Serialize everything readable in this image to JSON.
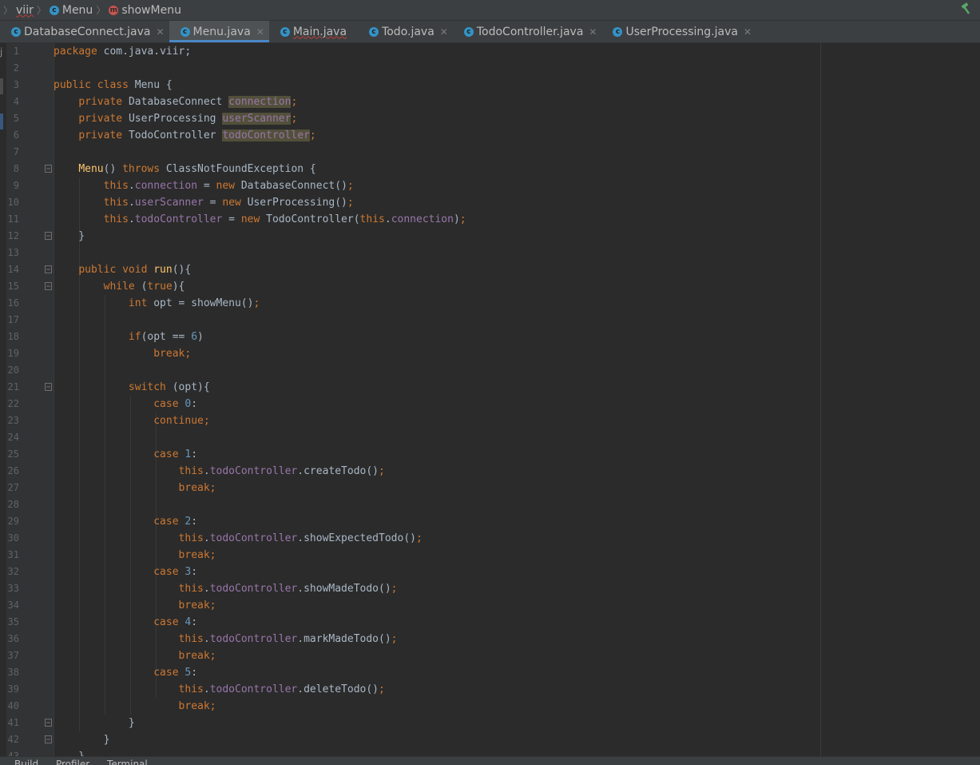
{
  "breadcrumb": {
    "items": [
      {
        "label": "viir",
        "icon": "folder",
        "underline": true
      },
      {
        "label": "Menu",
        "icon": "class-icon"
      },
      {
        "label": "showMenu",
        "icon": "method-icon"
      }
    ]
  },
  "tabs": [
    {
      "label": "DatabaseConnect.java",
      "active": false,
      "error": false
    },
    {
      "label": "Menu.java",
      "active": true,
      "error": false
    },
    {
      "label": "Main.java",
      "active": false,
      "error": true
    },
    {
      "label": "Todo.java",
      "active": false,
      "error": false
    },
    {
      "label": "TodoController.java",
      "active": false,
      "error": false
    },
    {
      "label": "UserProcessing.java",
      "active": false,
      "error": false
    }
  ],
  "code_lines": [
    [
      [
        "kw",
        "package "
      ],
      [
        "t",
        "com.java.viir;"
      ]
    ],
    [],
    [
      [
        "kw",
        "public class "
      ],
      [
        "t",
        "Menu {"
      ]
    ],
    [
      [
        "t",
        "    "
      ],
      [
        "kw",
        "private "
      ],
      [
        "t",
        "DatabaseConnect "
      ],
      [
        "hl",
        "connection"
      ],
      [
        "kw",
        ";"
      ]
    ],
    [
      [
        "t",
        "    "
      ],
      [
        "kw",
        "private "
      ],
      [
        "t",
        "UserProcessing "
      ],
      [
        "hl",
        "userScanner"
      ],
      [
        "kw",
        ";"
      ]
    ],
    [
      [
        "t",
        "    "
      ],
      [
        "kw",
        "private "
      ],
      [
        "t",
        "TodoController "
      ],
      [
        "hl",
        "todoController"
      ],
      [
        "kw",
        ";"
      ]
    ],
    [],
    [
      [
        "t",
        "    "
      ],
      [
        "fn",
        "Menu"
      ],
      [
        "t",
        "() "
      ],
      [
        "kw",
        "throws "
      ],
      [
        "t",
        "ClassNotFoundException {"
      ]
    ],
    [
      [
        "t",
        "        "
      ],
      [
        "kw",
        "this"
      ],
      [
        "t",
        "."
      ],
      [
        "fld",
        "connection"
      ],
      [
        "t",
        " = "
      ],
      [
        "kw",
        "new "
      ],
      [
        "t",
        "DatabaseConnect()"
      ],
      [
        "kw",
        ";"
      ]
    ],
    [
      [
        "t",
        "        "
      ],
      [
        "kw",
        "this"
      ],
      [
        "t",
        "."
      ],
      [
        "fld",
        "userScanner"
      ],
      [
        "t",
        " = "
      ],
      [
        "kw",
        "new "
      ],
      [
        "t",
        "UserProcessing()"
      ],
      [
        "kw",
        ";"
      ]
    ],
    [
      [
        "t",
        "        "
      ],
      [
        "kw",
        "this"
      ],
      [
        "t",
        "."
      ],
      [
        "fld",
        "todoController"
      ],
      [
        "t",
        " = "
      ],
      [
        "kw",
        "new "
      ],
      [
        "t",
        "TodoController("
      ],
      [
        "kw",
        "this"
      ],
      [
        "t",
        "."
      ],
      [
        "fld",
        "connection"
      ],
      [
        "t",
        ")"
      ],
      [
        "kw",
        ";"
      ]
    ],
    [
      [
        "t",
        "    }"
      ]
    ],
    [],
    [
      [
        "t",
        "    "
      ],
      [
        "kw",
        "public void "
      ],
      [
        "fn",
        "run"
      ],
      [
        "t",
        "(){"
      ]
    ],
    [
      [
        "t",
        "        "
      ],
      [
        "kw",
        "while "
      ],
      [
        "t",
        "("
      ],
      [
        "kw",
        "true"
      ],
      [
        "t",
        "){"
      ]
    ],
    [
      [
        "t",
        "            "
      ],
      [
        "kw",
        "int "
      ],
      [
        "t",
        "opt = showMenu()"
      ],
      [
        "kw",
        ";"
      ]
    ],
    [],
    [
      [
        "t",
        "            "
      ],
      [
        "kw",
        "if"
      ],
      [
        "t",
        "(opt == "
      ],
      [
        "num",
        "6"
      ],
      [
        "t",
        ")"
      ]
    ],
    [
      [
        "t",
        "                "
      ],
      [
        "kw",
        "break;"
      ]
    ],
    [],
    [
      [
        "t",
        "            "
      ],
      [
        "kw",
        "switch "
      ],
      [
        "t",
        "(opt){"
      ]
    ],
    [
      [
        "t",
        "                "
      ],
      [
        "kw",
        "case "
      ],
      [
        "num",
        "0"
      ],
      [
        "t",
        ":"
      ]
    ],
    [
      [
        "t",
        "                "
      ],
      [
        "kw",
        "continue;"
      ]
    ],
    [],
    [
      [
        "t",
        "                "
      ],
      [
        "kw",
        "case "
      ],
      [
        "num",
        "1"
      ],
      [
        "t",
        ":"
      ]
    ],
    [
      [
        "t",
        "                    "
      ],
      [
        "kw",
        "this"
      ],
      [
        "t",
        "."
      ],
      [
        "fld",
        "todoController"
      ],
      [
        "t",
        ".createTodo()"
      ],
      [
        "kw",
        ";"
      ]
    ],
    [
      [
        "t",
        "                    "
      ],
      [
        "kw",
        "break;"
      ]
    ],
    [],
    [
      [
        "t",
        "                "
      ],
      [
        "kw",
        "case "
      ],
      [
        "num",
        "2"
      ],
      [
        "t",
        ":"
      ]
    ],
    [
      [
        "t",
        "                    "
      ],
      [
        "kw",
        "this"
      ],
      [
        "t",
        "."
      ],
      [
        "fld",
        "todoController"
      ],
      [
        "t",
        ".showExpectedTodo()"
      ],
      [
        "kw",
        ";"
      ]
    ],
    [
      [
        "t",
        "                    "
      ],
      [
        "kw",
        "break;"
      ]
    ],
    [
      [
        "t",
        "                "
      ],
      [
        "kw",
        "case "
      ],
      [
        "num",
        "3"
      ],
      [
        "t",
        ":"
      ]
    ],
    [
      [
        "t",
        "                    "
      ],
      [
        "kw",
        "this"
      ],
      [
        "t",
        "."
      ],
      [
        "fld",
        "todoController"
      ],
      [
        "t",
        ".showMadeTodo()"
      ],
      [
        "kw",
        ";"
      ]
    ],
    [
      [
        "t",
        "                    "
      ],
      [
        "kw",
        "break;"
      ]
    ],
    [
      [
        "t",
        "                "
      ],
      [
        "kw",
        "case "
      ],
      [
        "num",
        "4"
      ],
      [
        "t",
        ":"
      ]
    ],
    [
      [
        "t",
        "                    "
      ],
      [
        "kw",
        "this"
      ],
      [
        "t",
        "."
      ],
      [
        "fld",
        "todoController"
      ],
      [
        "t",
        ".markMadeTodo()"
      ],
      [
        "kw",
        ";"
      ]
    ],
    [
      [
        "t",
        "                    "
      ],
      [
        "kw",
        "break;"
      ]
    ],
    [
      [
        "t",
        "                "
      ],
      [
        "kw",
        "case "
      ],
      [
        "num",
        "5"
      ],
      [
        "t",
        ":"
      ]
    ],
    [
      [
        "t",
        "                    "
      ],
      [
        "kw",
        "this"
      ],
      [
        "t",
        "."
      ],
      [
        "fld",
        "todoController"
      ],
      [
        "t",
        ".deleteTodo()"
      ],
      [
        "kw",
        ";"
      ]
    ],
    [
      [
        "t",
        "                    "
      ],
      [
        "kw",
        "break;"
      ]
    ],
    [
      [
        "t",
        "            }"
      ]
    ],
    [
      [
        "t",
        "        }"
      ]
    ],
    [
      [
        "t",
        "    }"
      ]
    ]
  ],
  "fold_lines": [
    8,
    12,
    14,
    15,
    21,
    41,
    42
  ],
  "bottom": {
    "items": [
      "Build",
      "Profiler",
      "Terminal"
    ]
  },
  "colors": {
    "keyword": "#cc7832",
    "field": "#9876aa",
    "number": "#6897bb",
    "method": "#ffc66d",
    "text": "#a9b7c6",
    "accent": "#4a88c7"
  }
}
